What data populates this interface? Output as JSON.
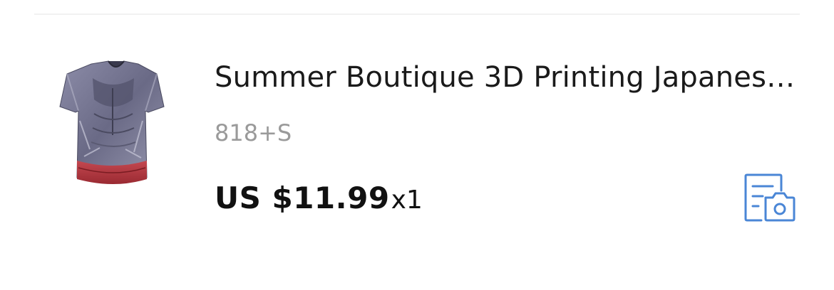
{
  "order_item": {
    "title": "Summer Boutique 3D Printing Japanese...",
    "sku": "818+S",
    "price": "US $11.99",
    "quantity": "x1",
    "thumbnail_icon": "tshirt-product-image",
    "action_icon": "photo-review-icon"
  },
  "colors": {
    "title_text": "#1a1a1a",
    "sku_text": "#9a9a9a",
    "price_text": "#111111",
    "icon_accent": "#4a86d6",
    "divider": "#f2f2f2"
  }
}
